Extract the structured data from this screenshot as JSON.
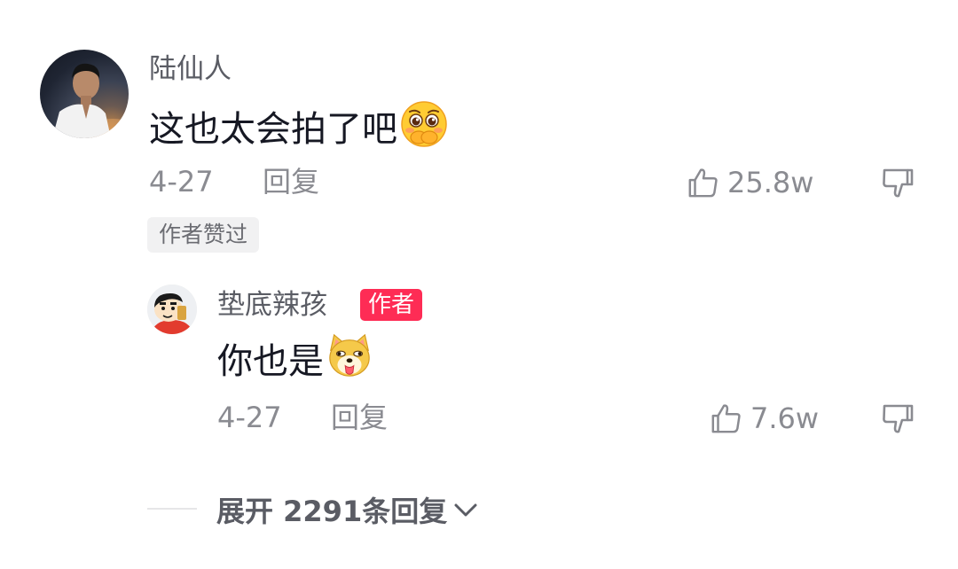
{
  "comment": {
    "username": "陆仙人",
    "text": "这也太会拍了吧",
    "emoji": "shy-blush-emoji",
    "date": "4-27",
    "reply_label": "回复",
    "likes": "25.8w",
    "author_liked_tag": "作者赞过"
  },
  "reply": {
    "username": "垫底辣孩",
    "author_badge": "作者",
    "text": "你也是",
    "emoji": "dog-tongue-emoji",
    "date": "4-27",
    "reply_label": "回复",
    "likes": "7.6w"
  },
  "expand": {
    "label": "展开 2291条回复"
  },
  "colors": {
    "primary_text": "#161823",
    "secondary_text": "#8a8b91",
    "username_text": "#5a5c64",
    "author_badge_bg": "#fe2c55",
    "tag_bg": "#f1f1f2"
  }
}
